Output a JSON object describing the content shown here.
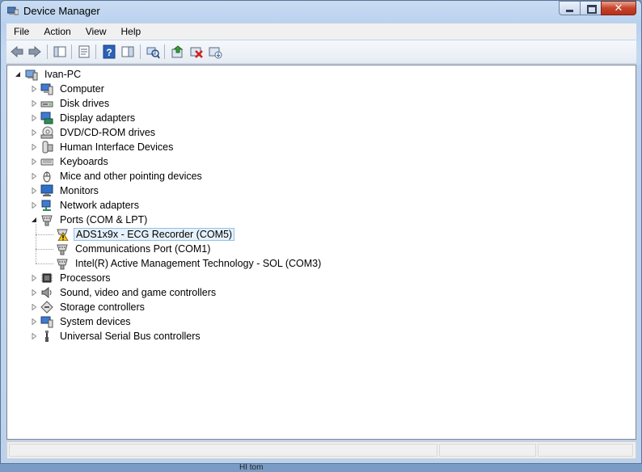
{
  "window": {
    "title": "Device Manager"
  },
  "menu": [
    "File",
    "Action",
    "View",
    "Help"
  ],
  "tree": {
    "root": "Ivan-PC",
    "categories": [
      {
        "label": "Computer",
        "icon": "computer-icon"
      },
      {
        "label": "Disk drives",
        "icon": "disk-drive-icon"
      },
      {
        "label": "Display adapters",
        "icon": "display-adapter-icon"
      },
      {
        "label": "DVD/CD-ROM drives",
        "icon": "dvd-drive-icon"
      },
      {
        "label": "Human Interface Devices",
        "icon": "hid-icon"
      },
      {
        "label": "Keyboards",
        "icon": "keyboard-icon"
      },
      {
        "label": "Mice and other pointing devices",
        "icon": "mouse-icon"
      },
      {
        "label": "Monitors",
        "icon": "monitor-icon"
      },
      {
        "label": "Network adapters",
        "icon": "network-adapter-icon"
      },
      {
        "label": "Ports (COM & LPT)",
        "icon": "port-icon",
        "expanded": true,
        "children": [
          {
            "label": "ADS1x9x - ECG Recorder (COM5)",
            "icon": "port-warning-icon",
            "selected": true
          },
          {
            "label": "Communications Port (COM1)",
            "icon": "port-icon"
          },
          {
            "label": "Intel(R) Active Management Technology - SOL (COM3)",
            "icon": "port-icon"
          }
        ]
      },
      {
        "label": "Processors",
        "icon": "processor-icon"
      },
      {
        "label": "Sound, video and game controllers",
        "icon": "sound-icon"
      },
      {
        "label": "Storage controllers",
        "icon": "storage-icon"
      },
      {
        "label": "System devices",
        "icon": "system-icon"
      },
      {
        "label": "Universal Serial Bus controllers",
        "icon": "usb-icon"
      }
    ]
  },
  "below_window_text": "HI tom"
}
